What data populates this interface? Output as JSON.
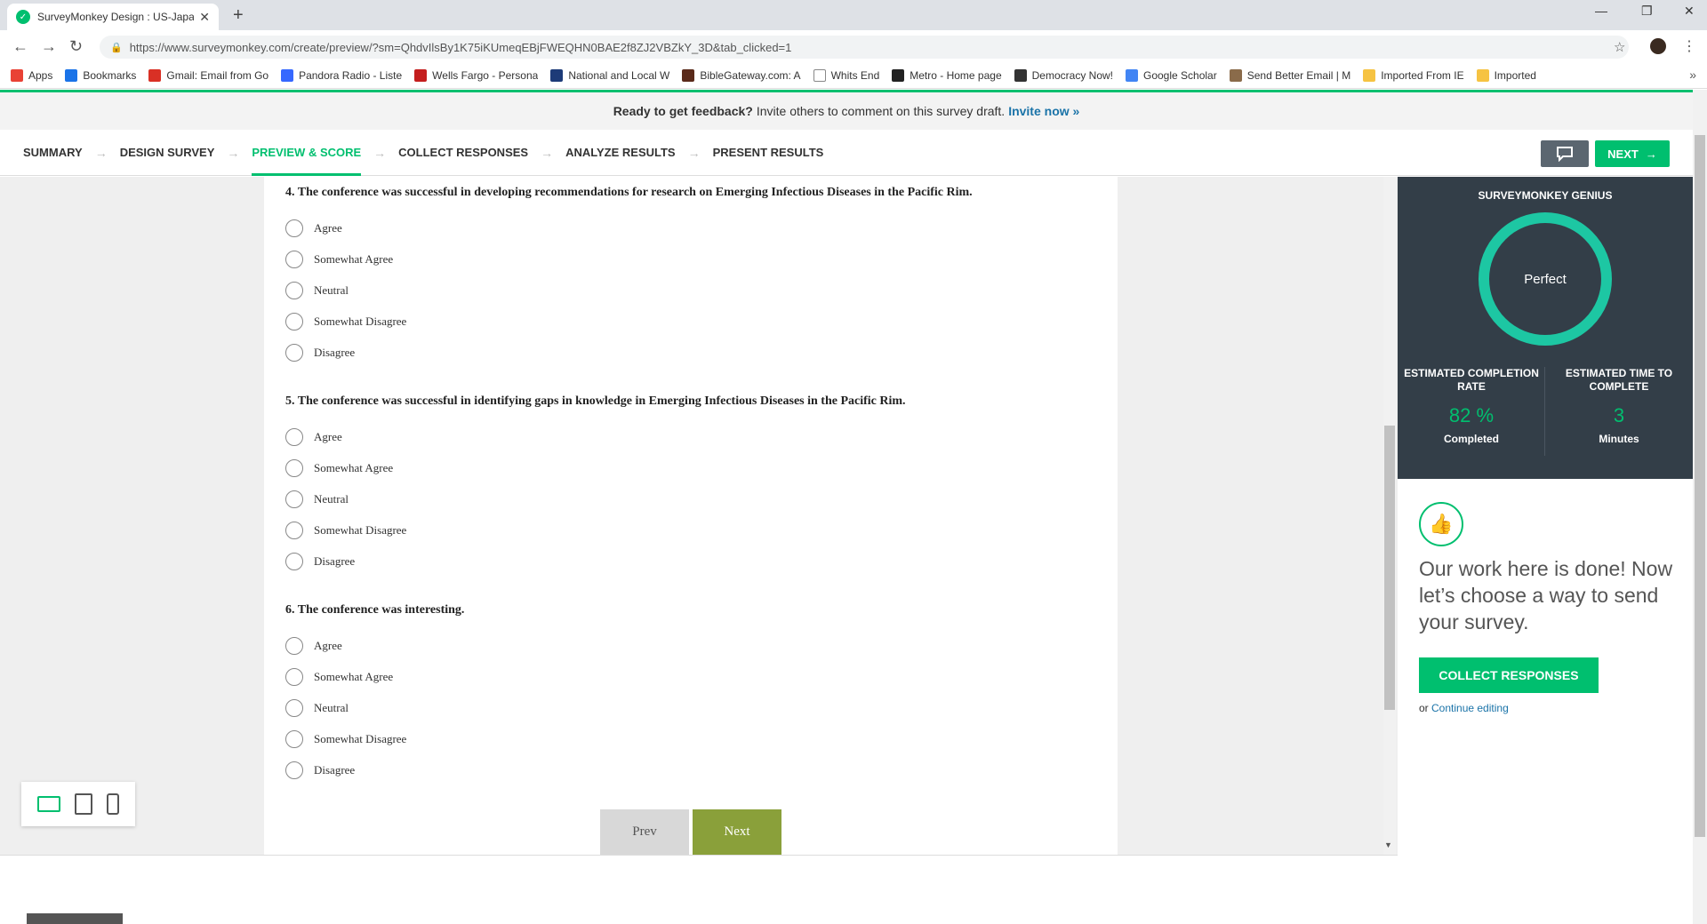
{
  "browser": {
    "tab_title": "SurveyMonkey Design : US-Japan",
    "url": "https://www.surveymonkey.com/create/preview/?sm=QhdvIlsBy1K75iKUmeqEBjFWEQHN0BAE2f8ZJ2VBZkY_3D&tab_clicked=1",
    "bookmarks": [
      "Apps",
      "Bookmarks",
      "Gmail: Email from Go",
      "Pandora Radio - Liste",
      "Wells Fargo - Persona",
      "National and Local W",
      "BibleGateway.com: A",
      "Whits End",
      "Metro - Home page",
      "Democracy Now!",
      "Google Scholar",
      "Send Better Email | M",
      "Imported From IE",
      "Imported"
    ]
  },
  "banner": {
    "bold": "Ready to get feedback?",
    "text": "Invite others to comment on this survey draft.",
    "link": "Invite now »"
  },
  "steps": [
    "SUMMARY",
    "DESIGN SURVEY",
    "PREVIEW & SCORE",
    "COLLECT RESPONSES",
    "ANALYZE RESULTS",
    "PRESENT RESULTS"
  ],
  "next_label": "NEXT",
  "questions": [
    {
      "title": "4. The conference was successful in developing recommendations for research on Emerging Infectious Diseases in the Pacific Rim.",
      "options": [
        "Agree",
        "Somewhat Agree",
        "Neutral",
        "Somewhat Disagree",
        "Disagree"
      ]
    },
    {
      "title": "5. The conference was successful in identifying gaps in knowledge in Emerging Infectious Diseases in the Pacific Rim.",
      "options": [
        "Agree",
        "Somewhat Agree",
        "Neutral",
        "Somewhat Disagree",
        "Disagree"
      ]
    },
    {
      "title": "6. The conference was interesting.",
      "options": [
        "Agree",
        "Somewhat Agree",
        "Neutral",
        "Somewhat Disagree",
        "Disagree"
      ]
    }
  ],
  "pager": {
    "prev": "Prev",
    "next": "Next"
  },
  "genius": {
    "title": "SURVEYMONKEY GENIUS",
    "ring_label": "Perfect",
    "completion_label": "ESTIMATED COMPLETION RATE",
    "completion_value": "82 %",
    "completion_sub": "Completed",
    "time_label": "ESTIMATED TIME TO COMPLETE",
    "time_value": "3",
    "time_sub": "Minutes"
  },
  "done": {
    "text": "Our work here is done! Now let’s choose a way to send your survey.",
    "button": "COLLECT RESPONSES",
    "or": "or",
    "link": "Continue editing"
  },
  "colors": {
    "brand": "#00bf6f",
    "panel": "#333e48",
    "next_btn": "#8aa03a"
  }
}
